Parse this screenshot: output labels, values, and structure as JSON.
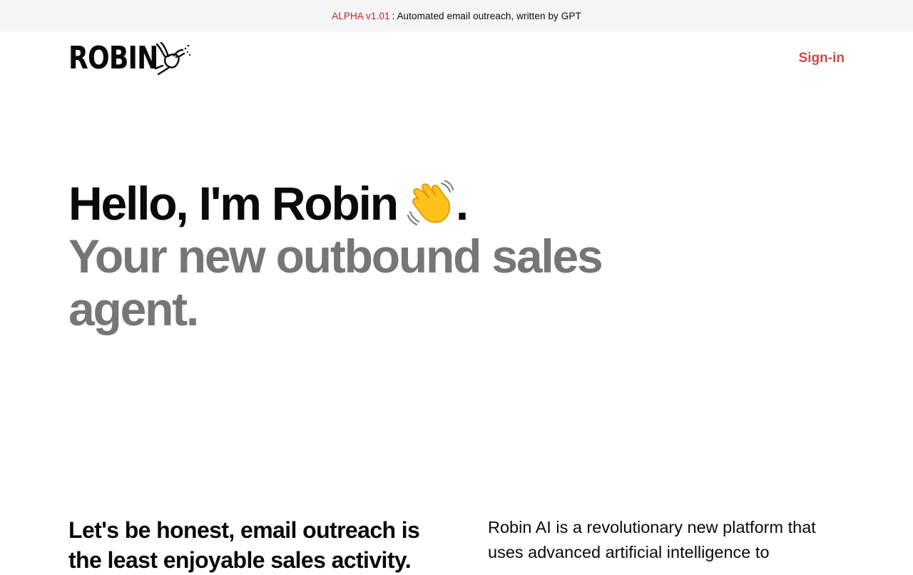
{
  "banner": {
    "version": "ALPHA v1.01",
    "separator": ":",
    "message": "Automated email outreach, written by GPT"
  },
  "header": {
    "logo_text": "ROBIN",
    "logo_icon": "hummingbird-icon",
    "signin_label": "Sign-in"
  },
  "hero": {
    "greeting": "Hello, I'm Robin",
    "greeting_icon": "waving-hand-icon",
    "greeting_end": ".",
    "tagline": "Your new outbound sales agent."
  },
  "features": {
    "heading": "Let's be honest, email outreach is the least enjoyable sales activity.",
    "body": "Robin AI is a revolutionary new platform that uses advanced artificial intelligence to"
  },
  "colors": {
    "accent": "#c94a4a",
    "banner_version": "#c81e1e",
    "banner_bg": "#f5f5f5",
    "tagline": "#767676"
  }
}
